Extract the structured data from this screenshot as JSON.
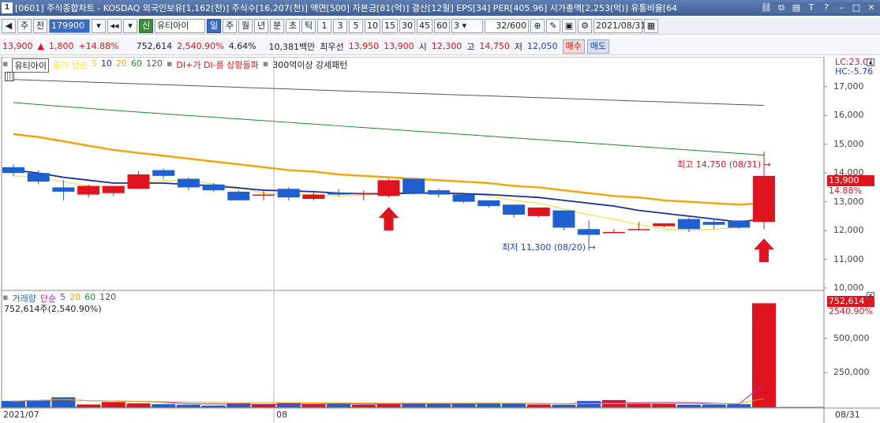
{
  "window": {
    "number": "1",
    "title": "[0601] 주식종합차트 - KOSDAQ 외국인보유[1,162(천)] 주식수[16,207(천)] 액면[500] 자본금[81(억)] 결산[12월] EPS[34] PER[405.96] 시가총액[2,253(억)] 유통비율[64"
  },
  "toolbar": {
    "type_label": "주",
    "jeon_label": "전",
    "code": "179900",
    "credit_label": "신",
    "stock_name": "유티아이",
    "periods": [
      "일",
      "주",
      "월",
      "년",
      "분",
      "초",
      "틱"
    ],
    "intervals": [
      "1",
      "3",
      "5",
      "10",
      "15",
      "30",
      "45",
      "60"
    ],
    "combo_value": "3",
    "page": "32/600",
    "date": "2021/08/31"
  },
  "quote": {
    "price": "13,900",
    "change": "1,800",
    "change_pct": "+14.88%",
    "volume": "752,614",
    "vol_ratio": "2,540.90%",
    "turnover": "4.64%",
    "amount": "10,381백만",
    "best_bid_label": "최우선",
    "best_ask": "13,950",
    "best_bid": "13,900",
    "open_label": "시",
    "open": "12,300",
    "high_label": "고",
    "high": "14,750",
    "low_label": "저",
    "low": "12,050",
    "buy_label": "매수",
    "sell_label": "매도"
  },
  "price_panel": {
    "stock_label": "유티아이",
    "ma_label": "종가 단순",
    "ma_periods": [
      "5",
      "10",
      "20",
      "60",
      "120"
    ],
    "signal1": "DI+가 DI-를 상향돌파",
    "signal2": "300억이상 강세패턴",
    "lc": "LC:23.01",
    "hc": "HC:-5.76",
    "last_price_label": "13,900",
    "last_pct_label": "14.88%",
    "high_annotation": "최고 14,750 (08/31) →",
    "low_annotation": "최저 11,300 (08/20) →",
    "y_ticks": [
      "17,000",
      "16,000",
      "15,000",
      "14,000",
      "13,000",
      "12,000",
      "11,000",
      "10,000"
    ]
  },
  "volume_panel": {
    "legend_label": "거래량",
    "ma_label": "단순",
    "ma_periods": [
      "5",
      "20",
      "60",
      "120"
    ],
    "info": "752,614주(2,540.90%)",
    "last_vol_label": "752,614",
    "last_pct_label": "2540.90%",
    "y_ticks": [
      "500,000",
      "250,000"
    ]
  },
  "x_axis": {
    "labels": [
      "2021/07",
      "08",
      "08/31"
    ]
  },
  "colors": {
    "up": "#e0141e",
    "down": "#1f5fd0",
    "ma5": "#f2e04a",
    "ma10": "#1c2fa0",
    "ma20": "#f0a60c",
    "ma60": "#1a8a2a",
    "ma120": "#555555"
  },
  "chart_data": {
    "type": "candlestick",
    "candles": [
      {
        "o": 14200,
        "h": 14300,
        "l": 13900,
        "c": 14000
      },
      {
        "o": 14000,
        "h": 14100,
        "l": 13600,
        "c": 13700
      },
      {
        "o": 13500,
        "h": 13750,
        "l": 13050,
        "c": 13350
      },
      {
        "o": 13250,
        "h": 13600,
        "l": 13150,
        "c": 13550
      },
      {
        "o": 13300,
        "h": 13550,
        "l": 13200,
        "c": 13550
      },
      {
        "o": 13450,
        "h": 14050,
        "l": 13450,
        "c": 13950
      },
      {
        "o": 14100,
        "h": 14150,
        "l": 13800,
        "c": 13900
      },
      {
        "o": 13800,
        "h": 13850,
        "l": 13400,
        "c": 13500
      },
      {
        "o": 13600,
        "h": 13650,
        "l": 13350,
        "c": 13400
      },
      {
        "o": 13350,
        "h": 13400,
        "l": 13050,
        "c": 13050
      },
      {
        "o": 13250,
        "h": 13400,
        "l": 13050,
        "c": 13250
      },
      {
        "o": 13450,
        "h": 13500,
        "l": 13050,
        "c": 13150
      },
      {
        "o": 13100,
        "h": 13350,
        "l": 13050,
        "c": 13250
      },
      {
        "o": 13300,
        "h": 13450,
        "l": 13200,
        "c": 13250
      },
      {
        "o": 13300,
        "h": 13400,
        "l": 13050,
        "c": 13300
      },
      {
        "o": 13200,
        "h": 13800,
        "l": 13150,
        "c": 13750
      },
      {
        "o": 13800,
        "h": 13800,
        "l": 13250,
        "c": 13300
      },
      {
        "o": 13400,
        "h": 13450,
        "l": 13150,
        "c": 13250
      },
      {
        "o": 13250,
        "h": 13300,
        "l": 12950,
        "c": 13000
      },
      {
        "o": 13050,
        "h": 13050,
        "l": 12800,
        "c": 12850
      },
      {
        "o": 12900,
        "h": 12900,
        "l": 12450,
        "c": 12550
      },
      {
        "o": 12500,
        "h": 12800,
        "l": 12450,
        "c": 12800
      },
      {
        "o": 12700,
        "h": 12700,
        "l": 12000,
        "c": 12100
      },
      {
        "o": 12050,
        "h": 12350,
        "l": 11300,
        "c": 11850
      },
      {
        "o": 11950,
        "h": 12050,
        "l": 11900,
        "c": 11950
      },
      {
        "o": 12050,
        "h": 12300,
        "l": 12000,
        "c": 12050
      },
      {
        "o": 12150,
        "h": 12250,
        "l": 12100,
        "c": 12250
      },
      {
        "o": 12400,
        "h": 12450,
        "l": 11950,
        "c": 12050
      },
      {
        "o": 12300,
        "h": 12400,
        "l": 12050,
        "c": 12200
      },
      {
        "o": 12350,
        "h": 12350,
        "l": 12050,
        "c": 12100
      },
      {
        "o": 12300,
        "h": 14750,
        "l": 12050,
        "c": 13900
      }
    ],
    "volumes": [
      45000,
      52000,
      72000,
      20000,
      38000,
      28000,
      22000,
      18000,
      12000,
      28000,
      20000,
      30000,
      22000,
      25000,
      18000,
      22000,
      30000,
      25000,
      28000,
      32000,
      30000,
      20000,
      18000,
      45000,
      52000,
      30000,
      25000,
      18000,
      20000,
      22000,
      752614
    ],
    "ma5": [
      13900,
      13850,
      13700,
      13550,
      13500,
      13600,
      13750,
      13720,
      13620,
      13500,
      13300,
      13250,
      13250,
      13200,
      13230,
      13300,
      13350,
      13350,
      13300,
      13200,
      13050,
      12950,
      12750,
      12550,
      12400,
      12200,
      12050,
      12000,
      12050,
      12100,
      12700
    ],
    "ma10": [
      14100,
      14000,
      13850,
      13750,
      13650,
      13650,
      13650,
      13600,
      13550,
      13480,
      13400,
      13380,
      13350,
      13300,
      13280,
      13280,
      13300,
      13300,
      13280,
      13250,
      13200,
      13150,
      13050,
      12950,
      12850,
      12700,
      12600,
      12500,
      12400,
      12300,
      12400
    ],
    "ma20": [
      15350,
      15250,
      15100,
      14950,
      14800,
      14700,
      14600,
      14500,
      14400,
      14300,
      14200,
      14100,
      14050,
      13950,
      13900,
      13850,
      13800,
      13750,
      13700,
      13650,
      13550,
      13500,
      13400,
      13300,
      13200,
      13150,
      13050,
      13000,
      12950,
      12900,
      12950
    ],
    "ma60": [
      16450,
      16380,
      16310,
      16250,
      16180,
      16120,
      16060,
      16000,
      15940,
      15880,
      15820,
      15760,
      15700,
      15640,
      15580,
      15520,
      15460,
      15400,
      15340,
      15280,
      15220,
      15160,
      15100,
      15040,
      14980,
      14920,
      14860,
      14800,
      14740,
      14680,
      14620
    ],
    "ma120": [
      17250,
      17220,
      17190,
      17160,
      17130,
      17100,
      17070,
      17040,
      17010,
      16980,
      16950,
      16920,
      16890,
      16860,
      16830,
      16800,
      16770,
      16740,
      16710,
      16680,
      16650,
      16620,
      16590,
      16560,
      16530,
      16500,
      16470,
      16440,
      16410,
      16380,
      16350
    ],
    "ylim": [
      10000,
      17600
    ],
    "vol_ylim": [
      0,
      760000
    ]
  }
}
